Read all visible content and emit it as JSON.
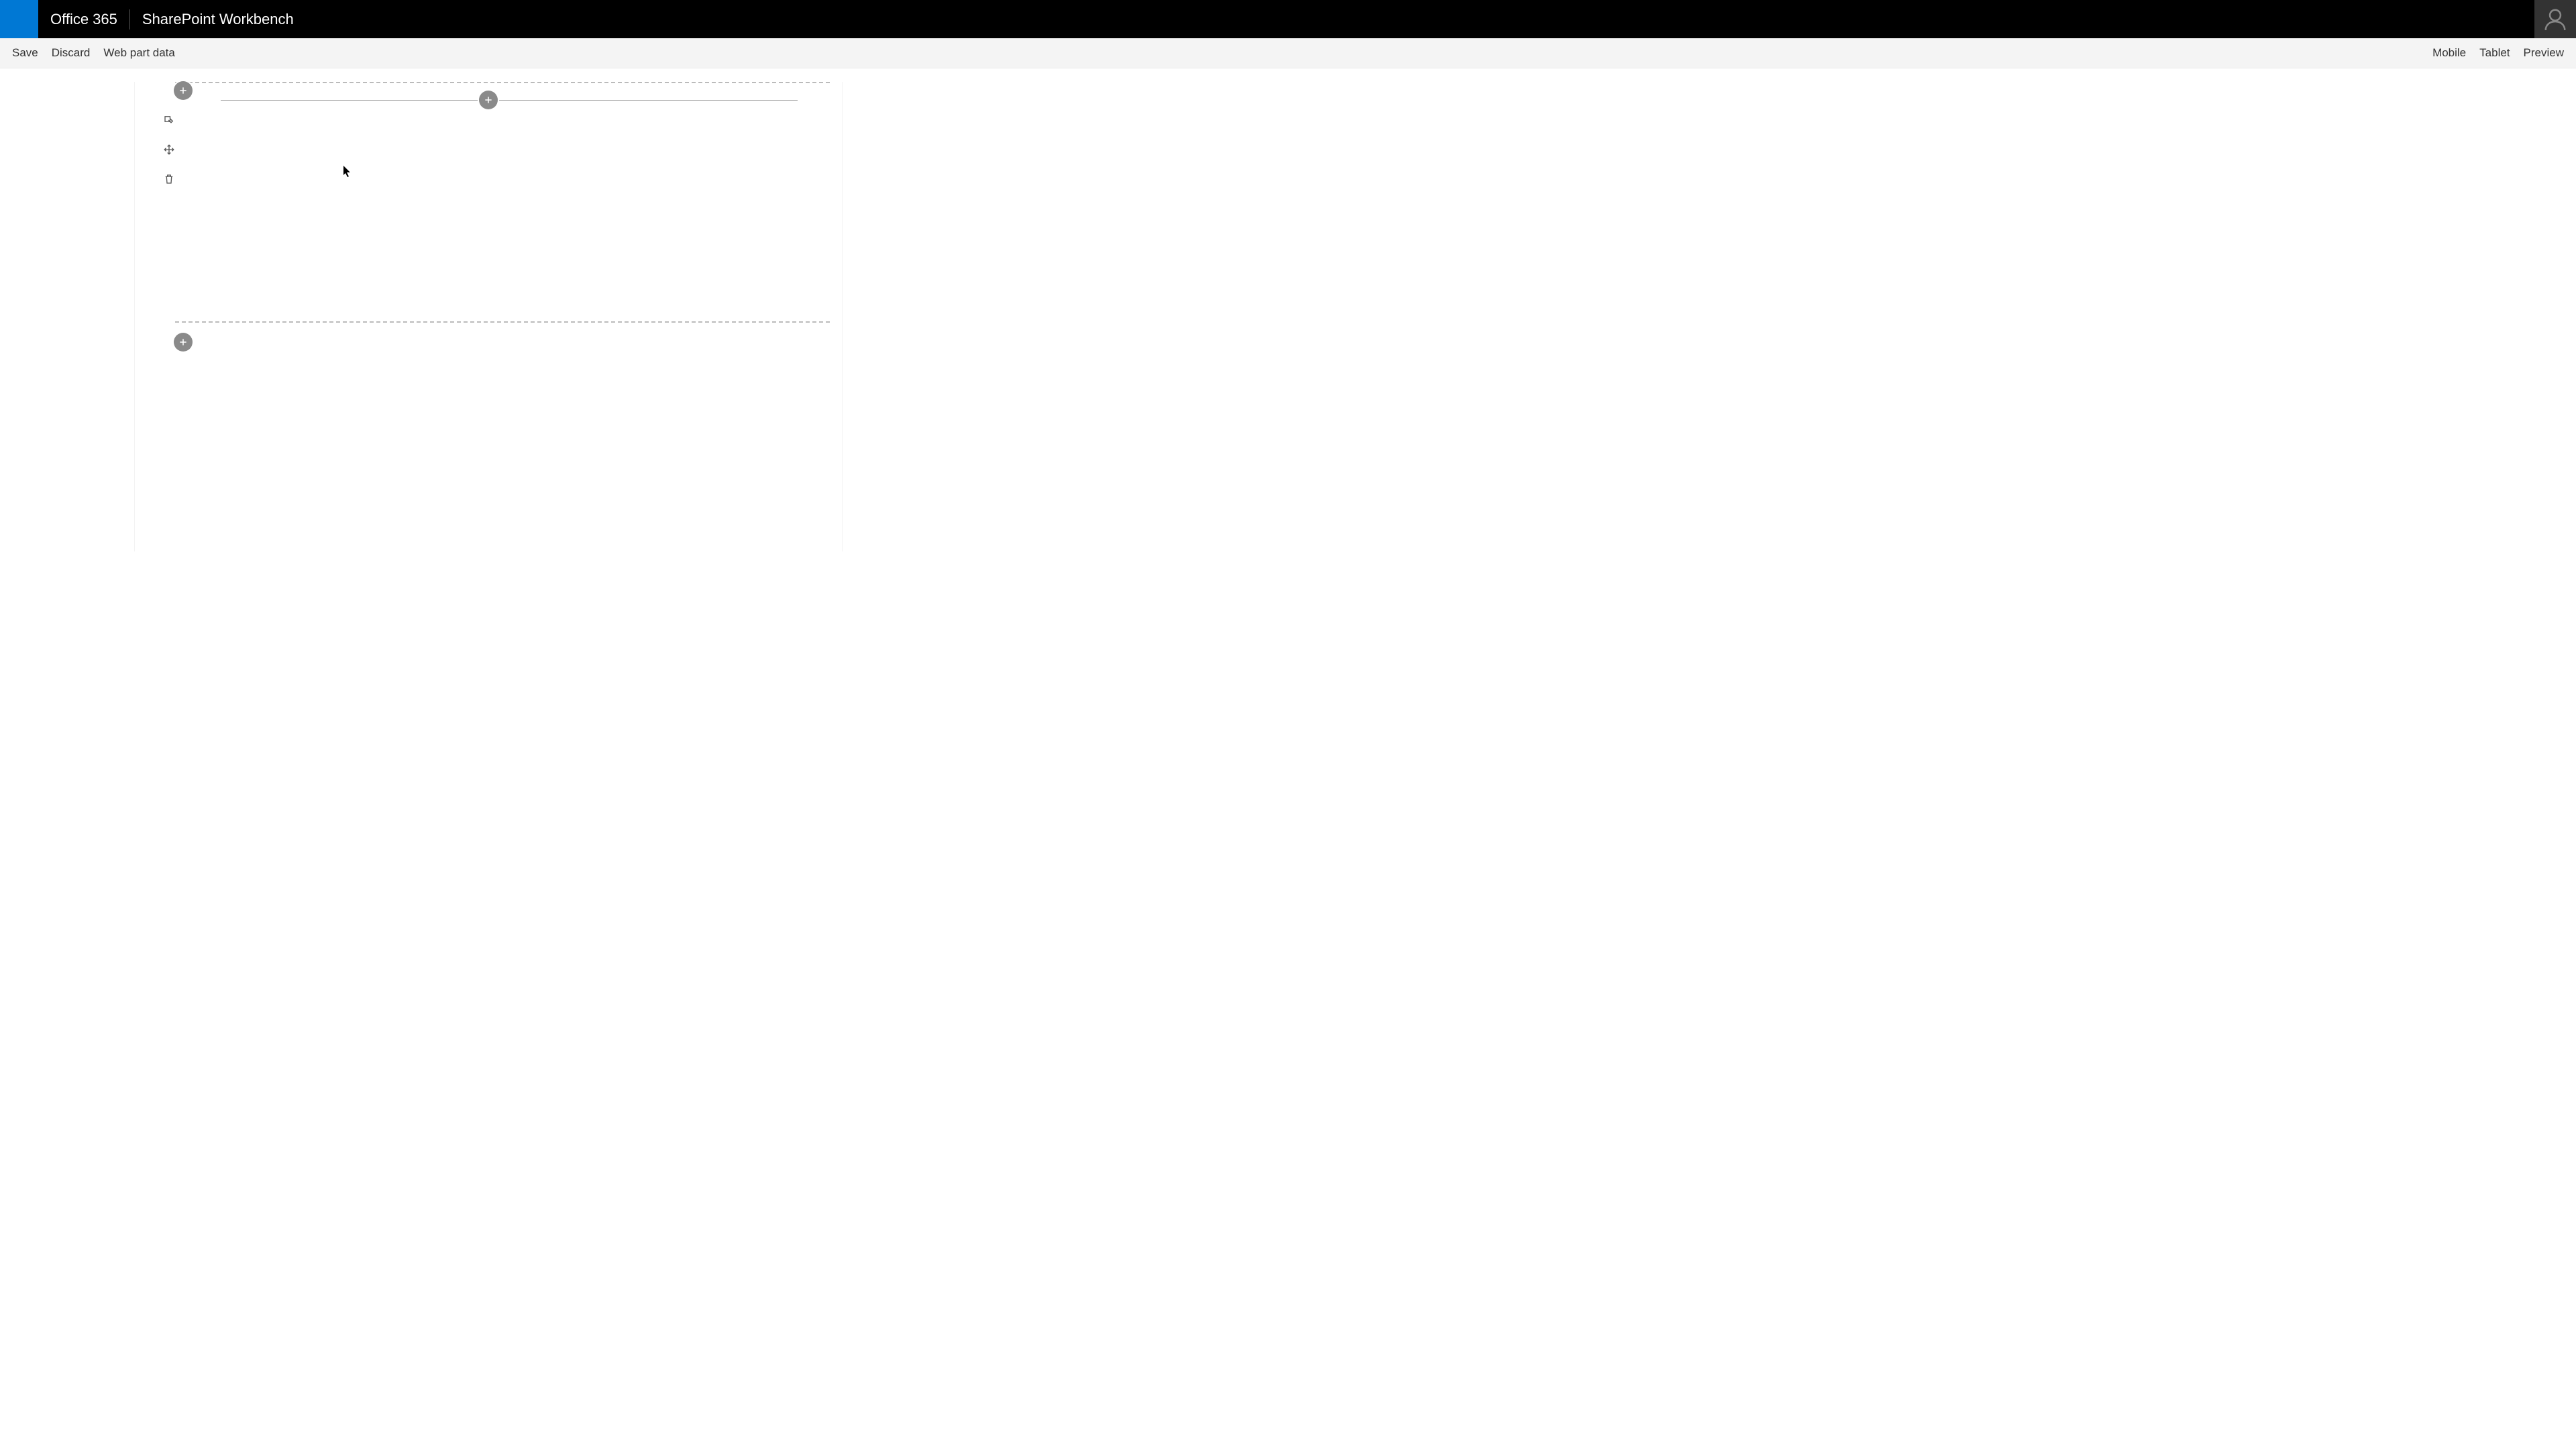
{
  "suite": {
    "title": "Office 365",
    "subtitle": "SharePoint Workbench"
  },
  "commands": {
    "left": [
      {
        "key": "save",
        "label": "Save"
      },
      {
        "key": "discard",
        "label": "Discard"
      },
      {
        "key": "webpartdata",
        "label": "Web part data"
      }
    ],
    "right": [
      {
        "key": "mobile",
        "label": "Mobile"
      },
      {
        "key": "tablet",
        "label": "Tablet"
      },
      {
        "key": "preview",
        "label": "Preview"
      }
    ]
  },
  "icons": {
    "plus": "plus-icon",
    "edit": "edit-icon",
    "move": "move-icon",
    "delete": "delete-icon",
    "avatar": "avatar-icon"
  },
  "colors": {
    "brand": "#0078d4",
    "suiteBar": "#000000",
    "commandBar": "#f4f4f4",
    "plusFill": "#8a8a8a",
    "dash": "#bbbbbb"
  }
}
